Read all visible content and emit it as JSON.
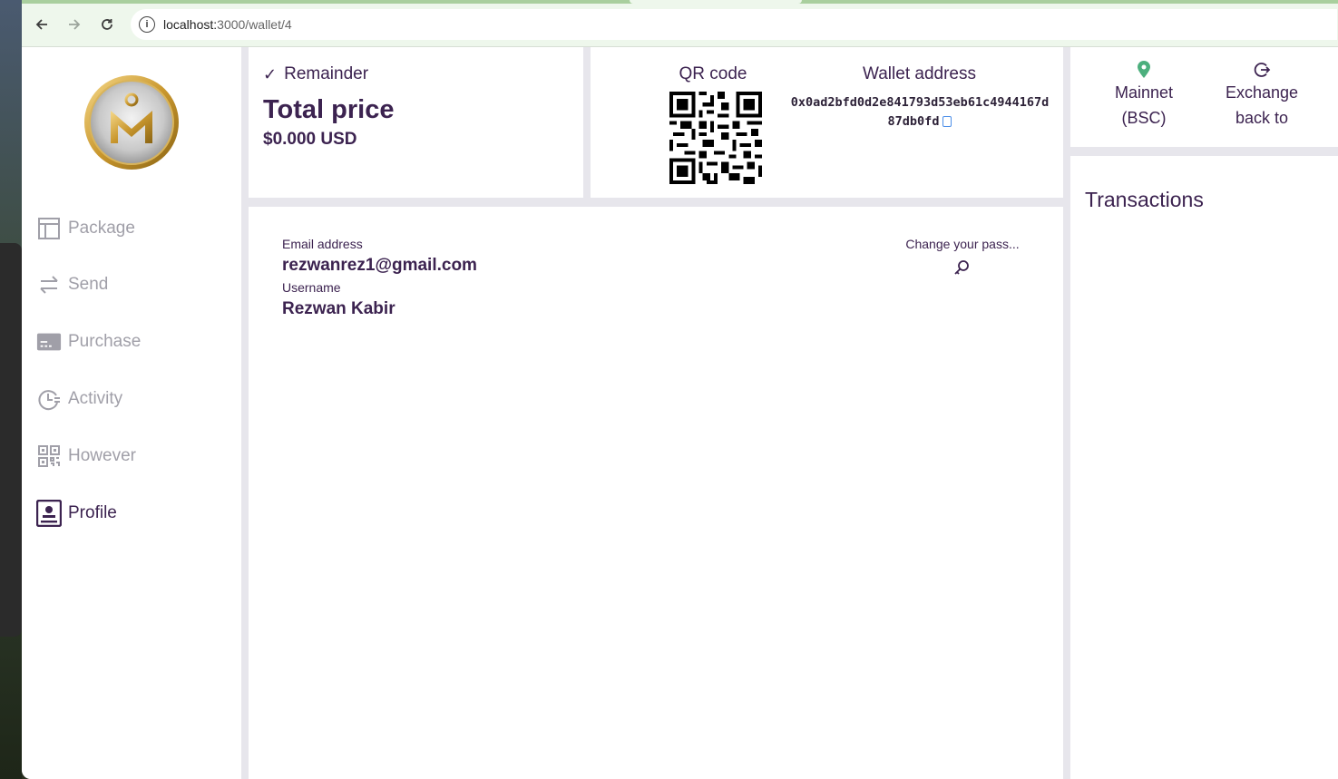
{
  "browser": {
    "url_host": "localhost:",
    "url_path": "3000/wallet/4",
    "back_icon": "arrow-left-icon",
    "forward_icon": "arrow-right-icon",
    "reload_icon": "reload-icon"
  },
  "sidebar": {
    "items": [
      {
        "label": "Package",
        "icon": "layout-icon"
      },
      {
        "label": "Send",
        "icon": "swap-arrows-icon"
      },
      {
        "label": "Purchase",
        "icon": "credit-card-icon"
      },
      {
        "label": "Activity",
        "icon": "clock-history-icon"
      },
      {
        "label": "However",
        "icon": "qr-code-icon"
      },
      {
        "label": "Profile",
        "icon": "profile-card-icon",
        "active": true
      }
    ]
  },
  "price_card": {
    "remainder_label": "Remainder",
    "total_title": "Total price",
    "total_value": "$0.000 USD"
  },
  "wallet_card": {
    "qr_label": "QR code",
    "wallet_label": "Wallet address",
    "address": "0x0ad2bfd0d2e841793d53eb61c4944167d87db0fd"
  },
  "profile_card": {
    "email_label": "Email address",
    "email_value": "rezwanrez1@gmail.com",
    "username_label": "Username",
    "username_value": "Rezwan Kabir",
    "change_password_label": "Change your pass..."
  },
  "network_card": {
    "network_line1": "Mainnet",
    "network_line2": "(BSC)",
    "exchange_line1": "Exchange",
    "exchange_line2": "back to"
  },
  "transactions_card": {
    "title": "Transactions"
  },
  "colors": {
    "primary": "#3c2350",
    "muted": "#a09fa8",
    "accent_green": "#4caf7d",
    "copy_blue": "#4d8fe8",
    "page_bg": "#e7e6ec"
  }
}
